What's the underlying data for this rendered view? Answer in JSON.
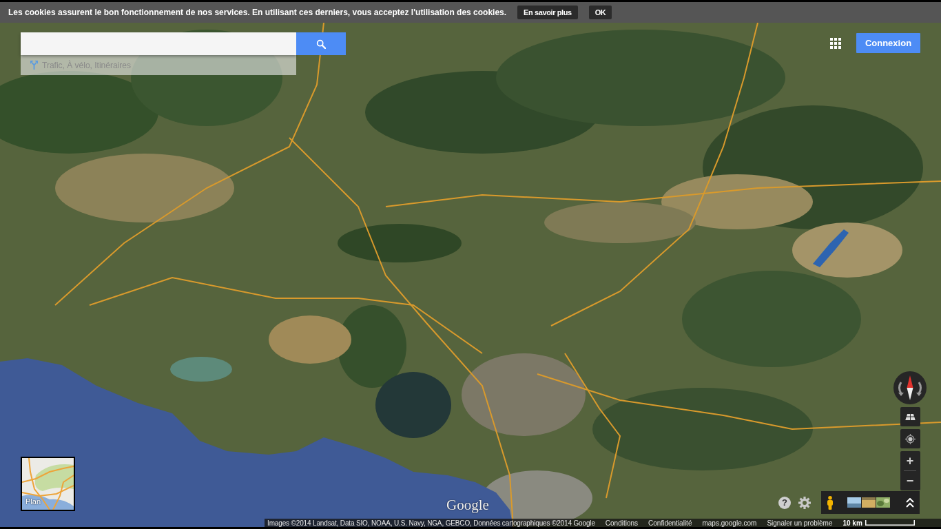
{
  "cookie_bar": {
    "message": "Les cookies assurent le bon fonctionnement de nos services. En utilisant ces derniers, vous acceptez l'utilisation des cookies.",
    "buttons": [
      "En savoir plus",
      "OK"
    ]
  },
  "search": {
    "hint": "Trafic, À vélo, Itinéraires"
  },
  "header": {
    "sign_in": "Connexion"
  },
  "map_controls": {
    "zoom": [
      "+",
      "−"
    ]
  },
  "layer_switcher": {
    "label": "Plan"
  },
  "bottom_controls": {
    "help": "?"
  },
  "logo": "Google",
  "footer": {
    "attribution": "Images ©2014 Landsat, Data SIO, NOAA, U.S. Navy, NGA, GEBCO, Données cartographiques ©2014 Google",
    "links": [
      "Conditions",
      "Confidentialité",
      "maps.google.com",
      "Signaler un problème"
    ],
    "scale": "10 km"
  }
}
